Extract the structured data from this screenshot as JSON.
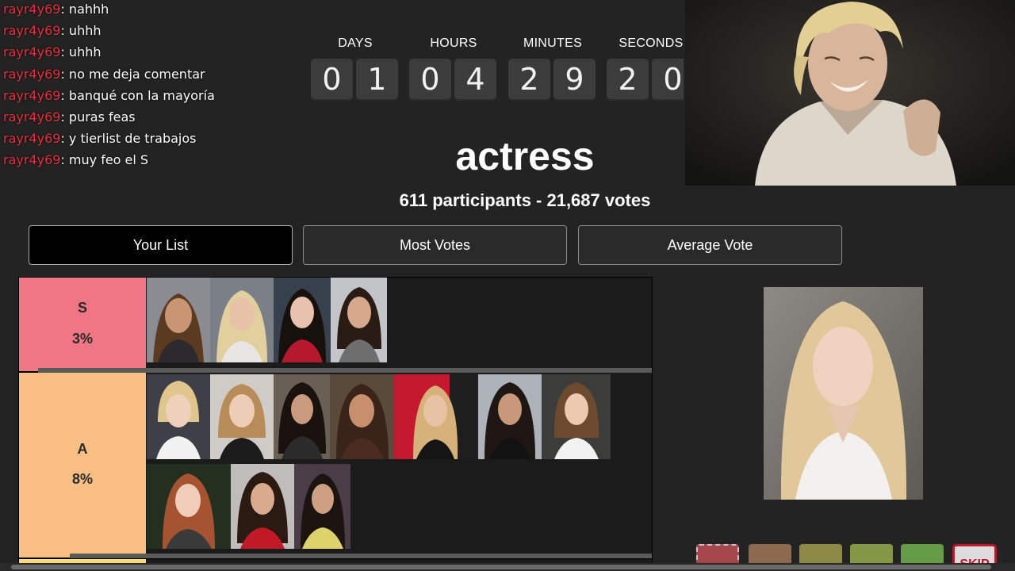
{
  "chat": {
    "username": "rayr4y69",
    "messages": [
      "nahhh",
      "uhhh",
      "uhhh",
      "no me deja comentar",
      "banqué con la mayoría",
      "puras feas",
      "y tierlist de trabajos",
      "muy feo el S"
    ]
  },
  "countdown": {
    "labels": [
      "DAYS",
      "HOURS",
      "MINUTES",
      "SECONDS"
    ],
    "digits": [
      [
        "0",
        "1"
      ],
      [
        "0",
        "4"
      ],
      [
        "2",
        "9"
      ],
      [
        "2",
        "0"
      ]
    ]
  },
  "title": "actress",
  "stats": "611 participants - 21,687 votes",
  "tabs": [
    "Your List",
    "Most Votes",
    "Average Vote"
  ],
  "tiers": [
    {
      "letter": "S",
      "percent": "3%",
      "color": "#f07585"
    },
    {
      "letter": "A",
      "percent": "8%",
      "color": "#f8be84"
    }
  ],
  "vote_colors": [
    "#a6464d",
    "#8d6a4f",
    "#8e8a45",
    "#849745",
    "#649c48"
  ],
  "skip_label": "SKIP"
}
